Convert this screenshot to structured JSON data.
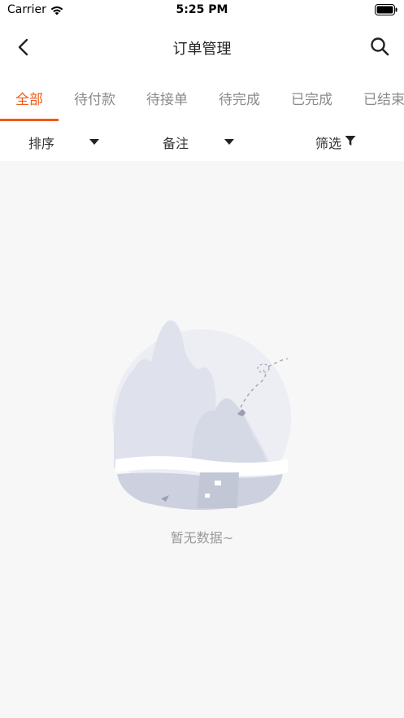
{
  "status_bar": {
    "carrier": "Carrier",
    "time": "5:25 PM"
  },
  "nav": {
    "title": "订单管理",
    "back_icon": "chevron-left-icon",
    "search_icon": "search-icon"
  },
  "tabs": [
    {
      "label": "全部",
      "active": true
    },
    {
      "label": "待付款",
      "active": false
    },
    {
      "label": "待接单",
      "active": false
    },
    {
      "label": "待完成",
      "active": false
    },
    {
      "label": "已完成",
      "active": false
    },
    {
      "label": "已结束",
      "active": false
    }
  ],
  "filters": {
    "sort_label": "排序",
    "note_label": "备注",
    "filter_label": "筛选"
  },
  "empty": {
    "message": "暂无数据~"
  },
  "colors": {
    "accent": "#f05a1a",
    "background": "#f7f7f7"
  }
}
